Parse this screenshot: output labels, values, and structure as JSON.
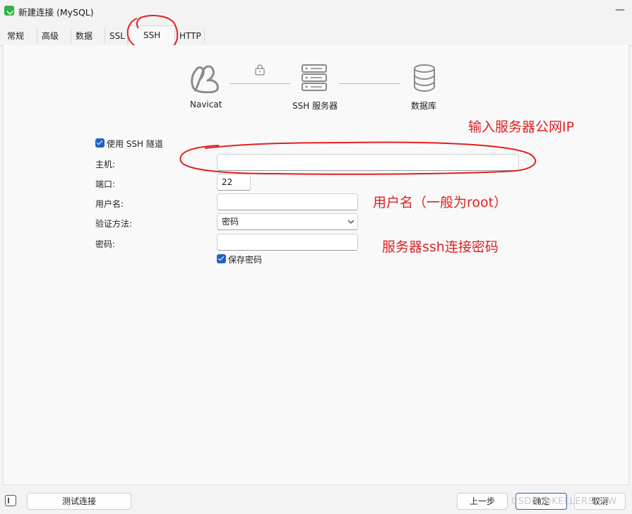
{
  "window": {
    "title": "新建连接 (MySQL)"
  },
  "tabs": [
    {
      "label": "常规"
    },
    {
      "label": "高级"
    },
    {
      "label": "数据库"
    },
    {
      "label": "SSL"
    },
    {
      "label": "SSH"
    },
    {
      "label": "HTTP"
    }
  ],
  "diagram": {
    "client": "Navicat",
    "server": "SSH 服务器",
    "database": "数据库"
  },
  "form": {
    "use_ssh_tunnel": "使用 SSH 隧道",
    "host_label": "主机:",
    "host_value": "",
    "port_label": "端口:",
    "port_value": "22",
    "username_label": "用户名:",
    "username_value": "",
    "auth_label": "验证方法:",
    "auth_value": "密码",
    "password_label": "密码:",
    "password_value": "",
    "save_password": "保存密码"
  },
  "annotations": {
    "host_note": "输入服务器公网IP",
    "username_note": "用户名（一般为root）",
    "password_note": "服务器ssh连接密码"
  },
  "footer": {
    "test_connection": "测试连接",
    "prev": "上一步",
    "ok": "确定",
    "cancel": "取消"
  },
  "watermark": "CSDN @KELLERSHAW",
  "colors": {
    "accent": "#1f63c4",
    "annotation": "#e02020",
    "app_icon": "#2fb344"
  }
}
